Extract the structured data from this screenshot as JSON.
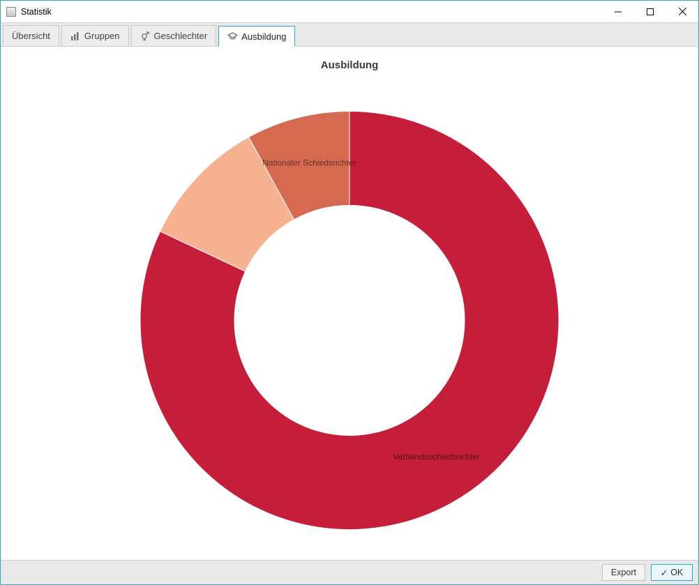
{
  "window": {
    "title": "Statistik"
  },
  "tabs": [
    {
      "label": "Übersicht",
      "icon": null
    },
    {
      "label": "Gruppen",
      "icon": "bars"
    },
    {
      "label": "Geschlechter",
      "icon": "gender"
    },
    {
      "label": "Ausbildung",
      "icon": "grad"
    }
  ],
  "active_tab": 3,
  "footer": {
    "export": "Export",
    "ok_prefix": "✓ ",
    "ok": "OK"
  },
  "chart_data": {
    "type": "pie",
    "title": "Ausbildung",
    "donut_inner_ratio": 0.55,
    "series": [
      {
        "name": "Verbandsschiedsrichter",
        "value": 82,
        "color": "#c41e3a",
        "label_visible": true
      },
      {
        "name": "",
        "value": 10,
        "color": "#f6b191",
        "label_visible": false
      },
      {
        "name": "Nationaler Schiedsrichter",
        "value": 8,
        "color": "#d66a50",
        "label_visible": true
      }
    ]
  }
}
